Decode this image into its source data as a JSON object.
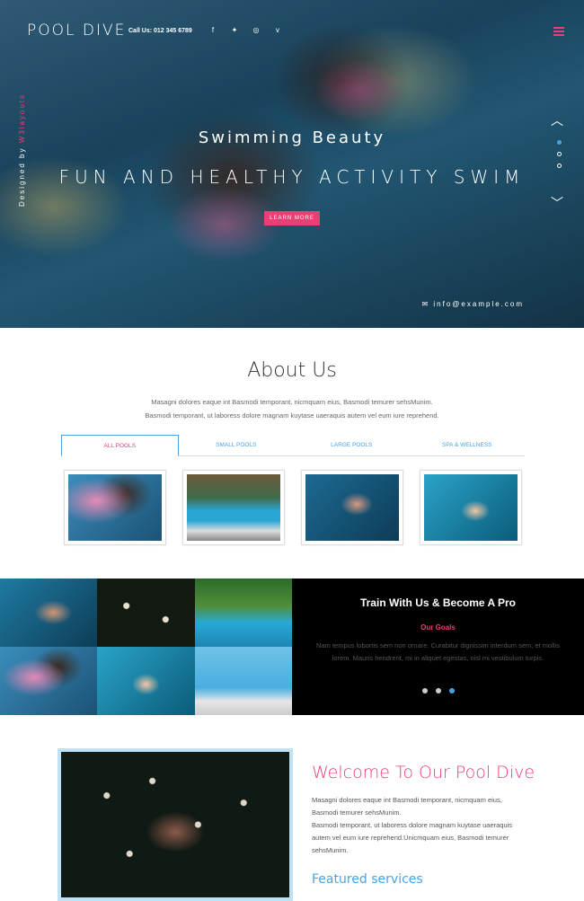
{
  "header": {
    "logo": "POOL DIVE",
    "call": "Call Us: 012 345 6789",
    "social_icons": [
      "facebook-icon",
      "twitter-icon",
      "dribbble-icon",
      "vimeo-icon"
    ],
    "vertical_text_prefix": "Designed by ",
    "vertical_text_brand": "W3layouts"
  },
  "hero": {
    "subtitle": "Swimming Beauty",
    "title": "FUN AND HEALTHY ACTIVITY SWIM",
    "button": "LEARN MORE",
    "email": "info@example.com"
  },
  "about": {
    "title": "About Us",
    "text1": "Masagni dolores eaque int Basmodi temporant, nicmquam eius, Basmodi temurer sehsMunim.",
    "text2": "Basmodi temporant, ut laboress dolore magnam kuytase uaeraquis autem vel eum iure reprehend.",
    "tabs": [
      "ALL POOLS",
      "SMALL POOLS",
      "LARGE POOLS",
      "SPA & WELLNESS"
    ]
  },
  "train": {
    "title": "Train With Us & Become A Pro",
    "subtitle": "Our Goals",
    "text": "Nam tempus lobortis sem non ornare. Curabitur dignissim interdum sem, et mollis lorem. Mauris hendrerit, mi in aliquet egestas, nisl mi vestibulum turpis."
  },
  "welcome": {
    "title": "Welcome To Our Pool Dive",
    "text1": "Masagni dolores eaque int Basmodi temporant, nicmquam eius, Basmodi temurer sehsMunim.",
    "text2": "Basmodi temporant, ut laboress dolore magnam kuytase uaeraquis autem vel eum iure reprehend.Unicmquam eius, Basmodi temurer sehsMunim.",
    "featured": "Featured services"
  },
  "colors": {
    "accent": "#e83f74",
    "blue": "#4aa3df"
  }
}
